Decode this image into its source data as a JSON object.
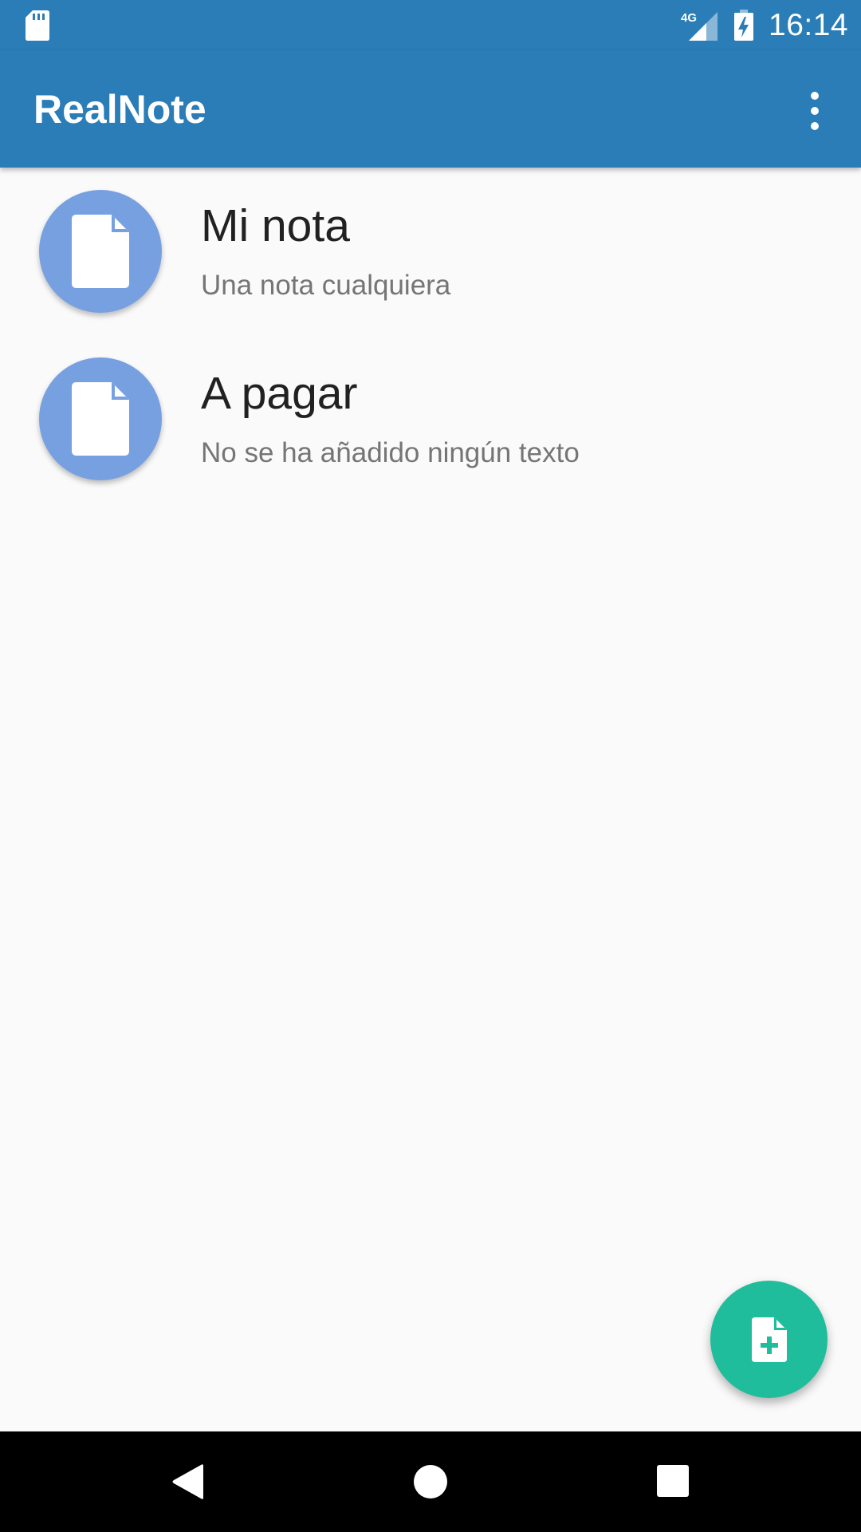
{
  "status_bar": {
    "network_label": "4G",
    "time": "16:14",
    "icons": [
      "sd-card-icon",
      "signal-icon",
      "battery-charging-icon"
    ]
  },
  "app_bar": {
    "title": "RealNote",
    "menu_icon": "overflow-menu-icon"
  },
  "notes": [
    {
      "title": "Mi nota",
      "subtitle": "Una nota cualquiera",
      "icon": "document-icon"
    },
    {
      "title": "A pagar",
      "subtitle": "No se ha añadido ningún texto",
      "icon": "document-icon"
    }
  ],
  "fab": {
    "icon": "add-note-icon"
  },
  "nav_bar": {
    "icons": [
      "back-icon",
      "home-icon",
      "recents-icon"
    ]
  },
  "colors": {
    "primary": "#2a7db7",
    "accent": "#1fbd9b",
    "avatar": "#77a0e1",
    "background": "#fafafa"
  }
}
